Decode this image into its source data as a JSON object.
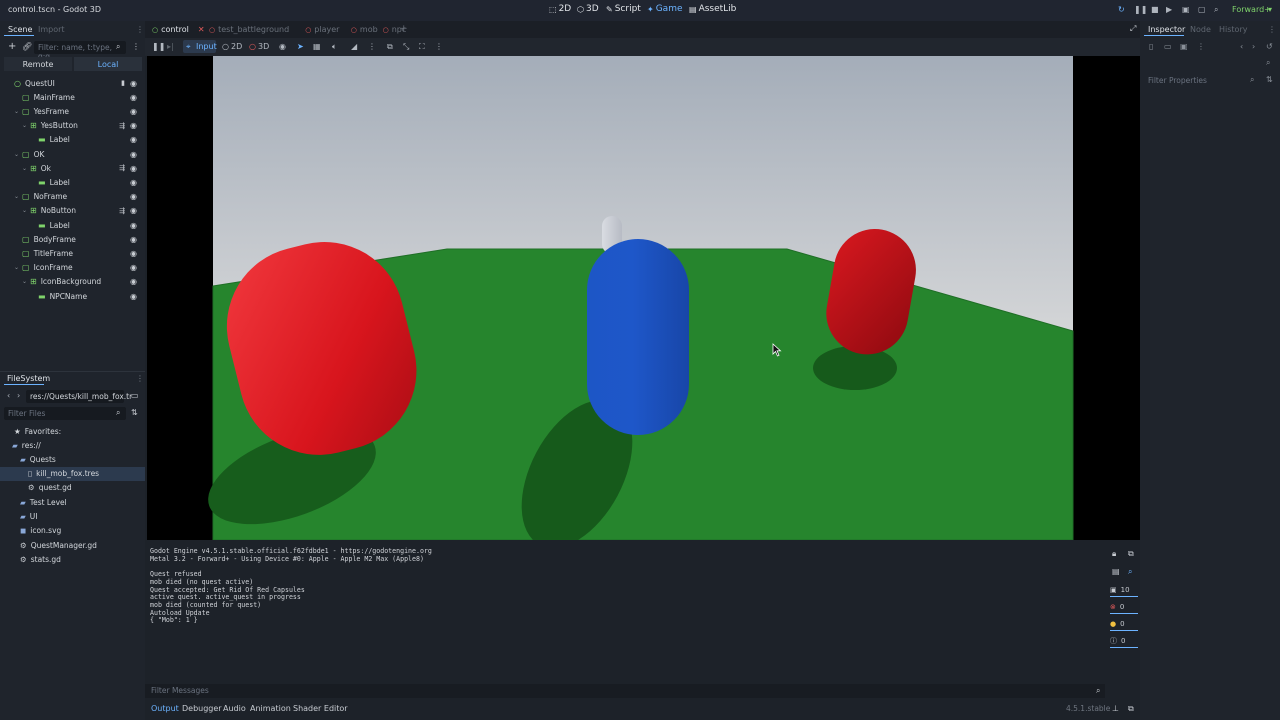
{
  "window": {
    "title": "control.tscn - Godot 3D",
    "renderer": "Forward+"
  },
  "modes": [
    {
      "label": "2D",
      "icon": "2d-icon"
    },
    {
      "label": "3D",
      "icon": "3d-icon"
    },
    {
      "label": "Script",
      "icon": "script-icon"
    },
    {
      "label": "Game",
      "icon": "game-icon"
    },
    {
      "label": "AssetLib",
      "icon": "assetlib-icon"
    }
  ],
  "scene_dock": {
    "tabs": [
      "Scene",
      "Import"
    ],
    "filter_placeholder": "Filter: name, t:type, g:g",
    "remote": "Remote",
    "local": "Local",
    "tree": [
      {
        "label": "QuestUI",
        "depth": 0,
        "root": true
      },
      {
        "label": "MainFrame",
        "depth": 1
      },
      {
        "label": "YesFrame",
        "depth": 1,
        "expanded": true
      },
      {
        "label": "YesButton",
        "depth": 2,
        "expanded": true,
        "button": true,
        "signal": true
      },
      {
        "label": "Label",
        "depth": 3,
        "label_node": true
      },
      {
        "label": "OK",
        "depth": 1,
        "expanded": true
      },
      {
        "label": "Ok",
        "depth": 2,
        "expanded": true,
        "button": true,
        "signal": true
      },
      {
        "label": "Label",
        "depth": 3,
        "label_node": true
      },
      {
        "label": "NoFrame",
        "depth": 1,
        "expanded": true
      },
      {
        "label": "NoButton",
        "depth": 2,
        "expanded": true,
        "button": true,
        "signal": true
      },
      {
        "label": "Label",
        "depth": 3,
        "label_node": true
      },
      {
        "label": "BodyFrame",
        "depth": 1
      },
      {
        "label": "TitleFrame",
        "depth": 1
      },
      {
        "label": "IconFrame",
        "depth": 1,
        "expanded": true
      },
      {
        "label": "IconBackground",
        "depth": 2,
        "expanded": true,
        "button": true
      },
      {
        "label": "NPCName",
        "depth": 3,
        "label_node": true
      }
    ]
  },
  "filesystem": {
    "title": "FileSystem",
    "path": "res://Quests/kill_mob_fox.tr",
    "filter_placeholder": "Filter Files",
    "favorites": "Favorites:",
    "items": [
      {
        "label": "res://",
        "depth": 0,
        "kind": "folder"
      },
      {
        "label": "Quests",
        "depth": 1,
        "kind": "folder"
      },
      {
        "label": "kill_mob_fox.tres",
        "depth": 2,
        "kind": "file",
        "selected": true
      },
      {
        "label": "quest.gd",
        "depth": 2,
        "kind": "gear"
      },
      {
        "label": "Test Level",
        "depth": 1,
        "kind": "folder"
      },
      {
        "label": "UI",
        "depth": 1,
        "kind": "folder"
      },
      {
        "label": "icon.svg",
        "depth": 1,
        "kind": "svg"
      },
      {
        "label": "QuestManager.gd",
        "depth": 1,
        "kind": "gear"
      },
      {
        "label": "stats.gd",
        "depth": 1,
        "kind": "gear"
      }
    ]
  },
  "editor_tabs": [
    {
      "label": "control",
      "active": true,
      "color": "#7fd36b"
    },
    {
      "label": "test_battleground",
      "active": false,
      "color": "#e05a5a"
    },
    {
      "label": "player",
      "active": false,
      "color": "#e05a5a"
    },
    {
      "label": "mob",
      "active": false,
      "color": "#e05a5a"
    },
    {
      "label": "npc",
      "active": false,
      "color": "#e05a5a"
    }
  ],
  "game_toolbar": {
    "input": "Input",
    "mode_2d": "2D",
    "mode_3d": "3D"
  },
  "output": {
    "lines": [
      "Godot Engine v4.5.1.stable.official.f62fdbde1 - https://godotengine.org",
      "Metal 3.2 - Forward+ - Using Device #0: Apple - Apple M2 Max (Apple8)",
      "",
      "Quest refused",
      "mob died (no quest active)",
      "Quest accepted: Get Rid Of Red Capsules",
      "active quest. active_quest in progress",
      "mob died (counted for quest)",
      "Autoload Update",
      "{ \"Mob\": 1 }"
    ],
    "filter_placeholder": "Filter Messages",
    "counts": {
      "messages": "10",
      "errors": "0",
      "warnings": "0",
      "info": "0"
    }
  },
  "bottom_tabs": [
    "Output",
    "Debugger",
    "Audio",
    "Animation",
    "Shader Editor"
  ],
  "version": "4.5.1.stable",
  "inspector": {
    "tabs": [
      "Inspector",
      "Node",
      "History"
    ],
    "filter_placeholder": "Filter Properties"
  },
  "colors": {
    "accent": "#6cb3ff",
    "node_green": "#7fd36b",
    "error": "#e05a5a",
    "warning": "#f0c040"
  }
}
